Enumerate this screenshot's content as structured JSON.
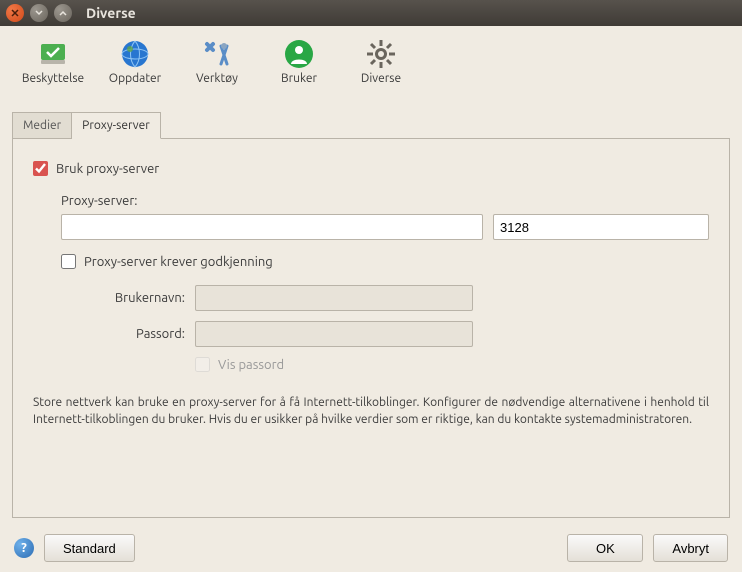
{
  "window": {
    "title": "Diverse"
  },
  "toolbar": {
    "items": [
      {
        "label": "Beskyttelse"
      },
      {
        "label": "Oppdater"
      },
      {
        "label": "Verktøy"
      },
      {
        "label": "Bruker"
      },
      {
        "label": "Diverse"
      }
    ]
  },
  "tabs": {
    "medier": "Medier",
    "proxy": "Proxy-server"
  },
  "proxy": {
    "use_proxy_label": "Bruk proxy-server",
    "use_proxy_checked": true,
    "server_label": "Proxy-server:",
    "server_value": "",
    "port_value": "3128",
    "auth_label": "Proxy-server krever godkjenning",
    "auth_checked": false,
    "username_label": "Brukernavn:",
    "username_value": "",
    "password_label": "Passord:",
    "password_value": "",
    "show_password_label": "Vis passord",
    "show_password_checked": false,
    "help_text": "Store nettverk kan bruke en proxy-server for å få Internett-tilkoblinger. Konfigurer de nødvendige alternativene i henhold til Internett-tilkoblingen du bruker. Hvis du er usikker på hvilke verdier som er riktige, kan du kontakte systemadministratoren."
  },
  "buttons": {
    "standard": "Standard",
    "ok": "OK",
    "cancel": "Avbryt"
  }
}
